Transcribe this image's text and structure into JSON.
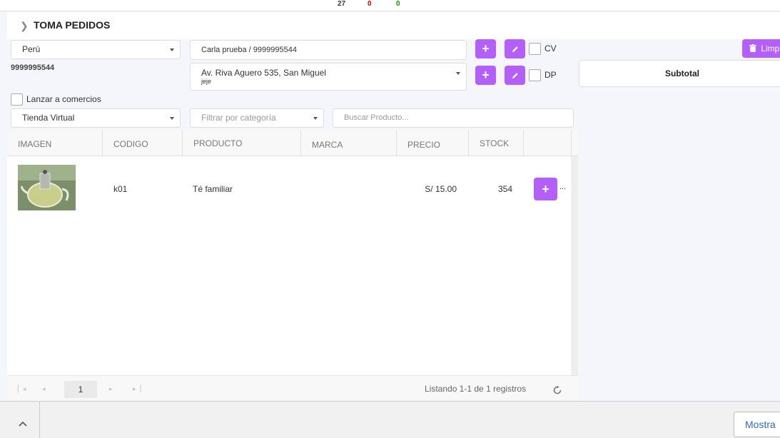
{
  "top_counters": [
    "27",
    "0",
    "0"
  ],
  "colors": {
    "accent": "#b55ffa",
    "red": "#e00000",
    "green": "#00a000"
  },
  "page": {
    "title": "TOMA PEDIDOS"
  },
  "form": {
    "country": "Perú",
    "phone": "9999995544",
    "client": "Carla prueba / 9999995544",
    "address_line1": "Av. Riva Aguero 535, San Miguel",
    "address_line2": "jeje",
    "cv_label": "CV",
    "dp_label": "DP",
    "lanzar_label": "Lanzar a comercios",
    "store": "Tienda Virtual",
    "category_placeholder": "Filtrar por categoría",
    "search_placeholder": "Buscar Producto..."
  },
  "right_panel": {
    "clear_label": "Limp",
    "subtotal_label": "Subtotal"
  },
  "table": {
    "columns": [
      "IMAGEN",
      "CODIGO",
      "PRODUCTO",
      "MARCA",
      "PRECIO",
      "STOCK"
    ],
    "rows": [
      {
        "code": "k01",
        "product": "Té familiar",
        "brand": "",
        "price": "S/ 15.00",
        "stock": "354",
        "more": "..."
      }
    ]
  },
  "pager": {
    "page": "1",
    "info": "Listando 1-1 de 1 registros"
  },
  "bottom": {
    "show_label": "Mostra"
  }
}
